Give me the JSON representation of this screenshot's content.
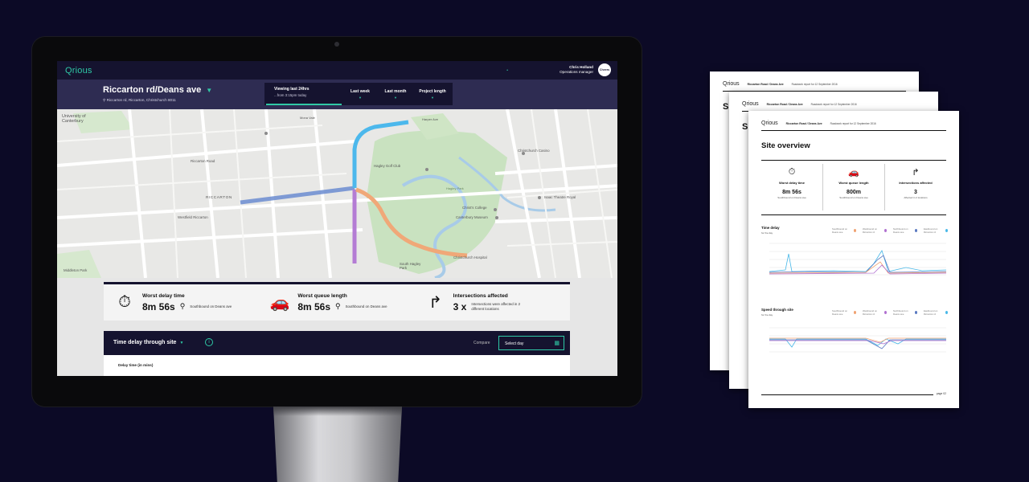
{
  "app": {
    "logo": "Qrious",
    "notify": "•",
    "user": {
      "name": "Chris Holland",
      "role": "Operations manager",
      "avatar": "Cheers"
    }
  },
  "location": {
    "title": "Riccarton rd/Deans ave",
    "address": "Riccarton rd, Riccarton, Christchurch 8011"
  },
  "periods": {
    "active_label": "Viewing last 24hrs",
    "active_sub": "...from 3:15pm today",
    "options": [
      "Last week",
      "Last month",
      "Project length"
    ]
  },
  "map": {
    "labels": [
      "University of Canterbury",
      "Riccarton Road",
      "RICCARTON",
      "Westfield Riccarton",
      "Hagley Golf Club",
      "Christ's College",
      "Canterbury Museum",
      "Christchurch Casino",
      "Isaac Theatre Royal",
      "South Hagley Park",
      "Christchurch Hospital",
      "Middleton Park",
      "Hagley Park",
      "Harper Ave",
      "Mona Vale"
    ]
  },
  "stats": [
    {
      "title": "Worst delay time",
      "value": "8m 56s",
      "note": "Southbound on Deans ave",
      "icon": "stopwatch-icon"
    },
    {
      "title": "Worst queue length",
      "value": "8m 56s",
      "note": "Southbound on Deans ave",
      "icon": "cars-icon"
    },
    {
      "title": "Intersections affected",
      "value": "3 x",
      "note": "Intersections were affected in 2 different locations",
      "icon": "fork-arrow-icon"
    }
  ],
  "delay_panel": {
    "title": "Time delay through site",
    "compare": "Compare",
    "select_day": "Select day",
    "body_label": "Delay time (in mins)"
  },
  "report": {
    "logo": "Qrious",
    "road": "Riccarton Road / Deans Ave",
    "date": "Roadwork report for 12 September 2016",
    "title": "Site overview",
    "stub": "Si",
    "overview": [
      {
        "title": "Worst delay time",
        "value": "8m 56s",
        "note": "Southbound on Deans ave"
      },
      {
        "title": "Worst queue length",
        "value": "800m",
        "note": "Southbound on Deans ave"
      },
      {
        "title": "Intersections affected",
        "value": "3",
        "note": "Affected in 2 locations"
      }
    ],
    "time_delay": {
      "title": "Time delay",
      "sub": "for the day"
    },
    "speed": {
      "title": "Speed through site",
      "sub": "for the day"
    },
    "legend": [
      "Southbound on Deans ave",
      "Westbound on Riccarton rd",
      "Northbound on Deans ave",
      "Eastbound on Riccarton rd"
    ],
    "page": "page 02"
  },
  "colors": {
    "accent": "#2fc9a6",
    "navy": "#15132f",
    "series": [
      "#f0a070",
      "#b070d0",
      "#5878c0",
      "#48b8e8"
    ]
  }
}
